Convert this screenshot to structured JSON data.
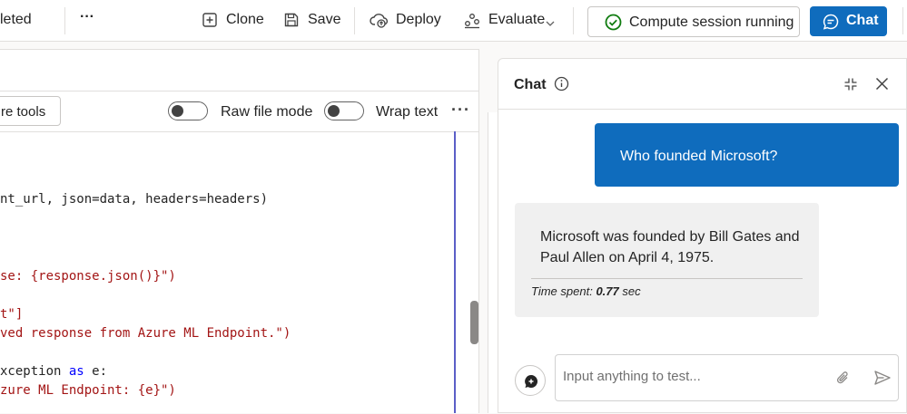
{
  "topbar": {
    "truncated_status": "leted",
    "more_label": "···",
    "clone_label": "Clone",
    "save_label": "Save",
    "deploy_label": "Deploy",
    "evaluate_label": "Evaluate",
    "compute_label": "Compute session running",
    "chat_label": "Chat"
  },
  "editor": {
    "more_tools_label": "re tools",
    "raw_file_mode_label": "Raw file mode",
    "raw_file_mode_on": false,
    "wrap_text_label": "Wrap text",
    "wrap_text_on": false,
    "more_label": "···",
    "code_lines": [
      {
        "plain": "nt_url, json=data, headers=headers)"
      },
      {
        "str": "se: {response.json()}\")"
      },
      {
        "str": "t\"]"
      },
      {
        "str": "ved response from Azure ML Endpoint.\")"
      },
      {
        "plain": "xception ",
        "kw": "as",
        "plain2": " e:"
      },
      {
        "str": "zure ML Endpoint: {e}\")"
      }
    ]
  },
  "chat": {
    "title": "Chat",
    "info_icon": "info-icon",
    "user_message": "Who founded Microsoft?",
    "bot_message": "Microsoft was founded by Bill Gates and Paul Allen on April 4, 1975.",
    "time_spent_label": "Time spent:",
    "time_spent_value": "0.77",
    "time_spent_unit": "sec",
    "input_placeholder": "Input anything to test..."
  },
  "colors": {
    "accent": "#0f6cbd",
    "success": "#107c10",
    "code_string": "#a31515",
    "code_keyword": "#0000ff"
  }
}
